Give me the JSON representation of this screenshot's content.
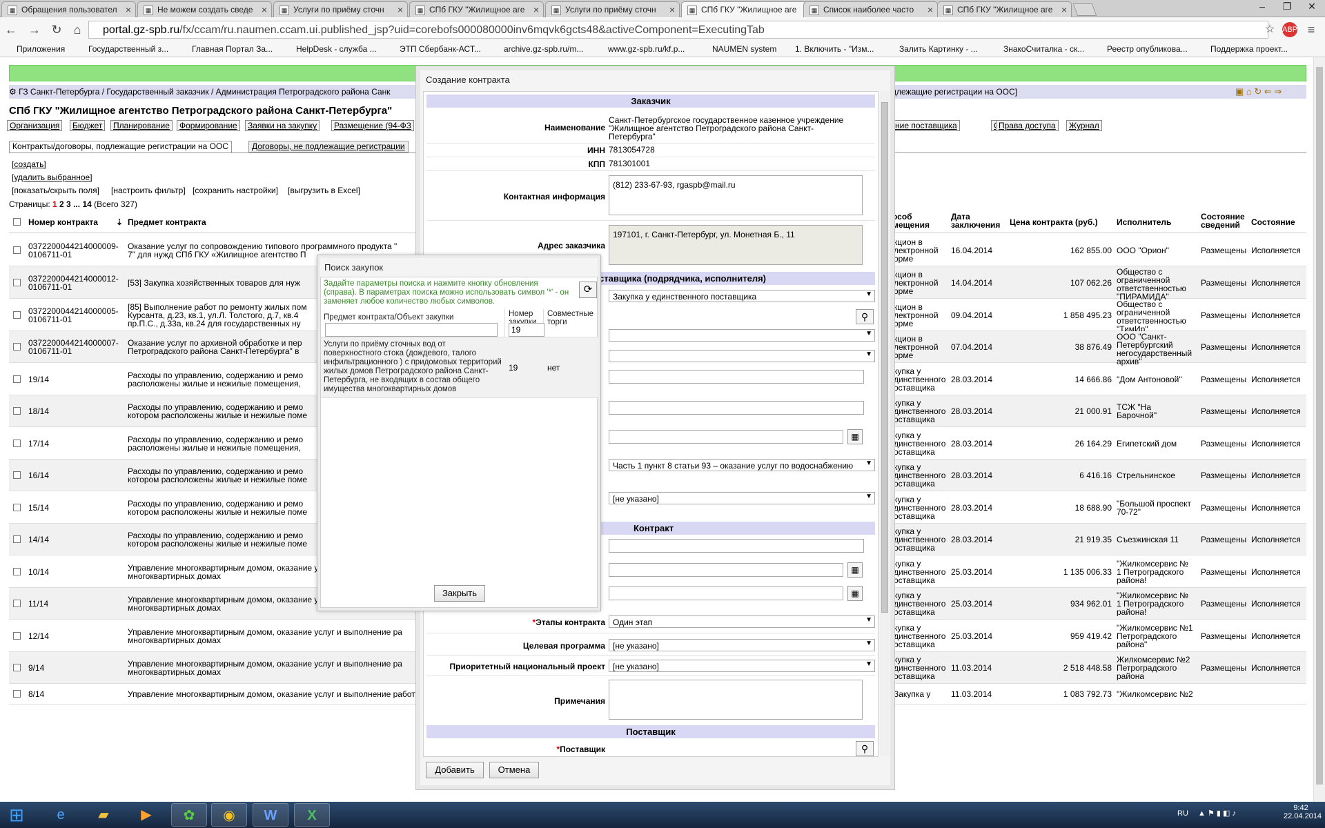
{
  "browser": {
    "tabs": [
      {
        "label": "Обращения пользовател",
        "active": false
      },
      {
        "label": "Не можем создать сведе",
        "active": false
      },
      {
        "label": "Услуги по приёму сточн",
        "active": false
      },
      {
        "label": "СПб ГКУ \"Жилищное аге",
        "active": false
      },
      {
        "label": "Услуги по приёму сточн",
        "active": false
      },
      {
        "label": "СПб ГКУ \"Жилищное аге",
        "active": true
      },
      {
        "label": "Список наиболее часто",
        "active": false
      },
      {
        "label": "СПб ГКУ \"Жилищное аге",
        "active": false
      }
    ],
    "url_host": "portal.gz-spb.ru",
    "url_path": "/fx/ccam/ru.naumen.ccam.ui.published_jsp?uid=corebofs000080000inv6mqvk6gcts48&activeComponent=ExecutingTab",
    "bookmarks": [
      {
        "label": "Приложения",
        "color": "#4a7fd6"
      },
      {
        "label": "Государственный з...",
        "color": "#1c5fb8"
      },
      {
        "label": "Главная Портал За...",
        "color": "#b8862c"
      },
      {
        "label": "HelpDesk - служба ...",
        "color": "#2c7fd1"
      },
      {
        "label": "ЭТП Сбербанк-АСТ...",
        "color": "#e8e8e8"
      },
      {
        "label": "archive.gz-spb.ru/m...",
        "color": "#d9362f"
      },
      {
        "label": "www.gz-spb.ru/kf.p...",
        "color": "#d9362f"
      },
      {
        "label": "NAUMEN system",
        "color": "#e8e8e8"
      },
      {
        "label": "1. Включить - \"Изм...",
        "color": "#555555"
      },
      {
        "label": "Залить Картинку - ...",
        "color": "#2c7fd1"
      },
      {
        "label": "ЗнакоСчиталка - ск...",
        "color": "#e8e8e8"
      },
      {
        "label": "Реестр опубликова...",
        "color": "#b8862c"
      },
      {
        "label": "Поддержка проект...",
        "color": "#d9362f"
      }
    ]
  },
  "page": {
    "breadcrumb": "ГЗ Санкт-Петербурга / Государственный заказчик / Администрация Петроградского района Санк",
    "breadcrumb_tail": "длежащие регистрации на ООС]",
    "org_title": "СПб ГКУ \"Жилищное агентство Петроградского района Санкт-Петербурга\"",
    "menu": [
      "Организация",
      "Бюджет",
      "Планирование",
      "Формирование",
      "Заявки на закупку",
      "Размещение (94-ФЗ",
      "ние поставщика",
      "ООС",
      "Права доступа",
      "Журнал"
    ],
    "subtabs": [
      "Контракты/договоры, подлежащие регистрации на ООС",
      "Договоры, не подлежащие регистрации"
    ],
    "actions": {
      "create": "[создать]",
      "delete": "[удалить выбранное]",
      "show_hide": "[показать/скрыть поля]",
      "filter": "[настроить фильтр]",
      "save": "[сохранить настройки]",
      "excel": "[выгрузить в Excel]"
    },
    "pager": {
      "label": "Страницы:",
      "current": "1",
      "pages": "2 3",
      "dots": "...",
      "last": "14",
      "total": "(Всего 327)"
    },
    "columns": {
      "number": "Номер контракта",
      "subject": "Предмет контракта",
      "method": "особ\nмещения",
      "date": "Дата\nзаключения",
      "price": "Цена контракта (руб.)",
      "executor": "Исполнитель",
      "info_state": "Состояние\nсведений",
      "state": "Состояние"
    },
    "rows": [
      {
        "number": "0372200044214000009-\n0106711-01",
        "subject": "Оказание услуг по сопровождению типового программного продукта \"\n7\" для нужд СПб ГКУ «Жилищное агентство П",
        "method": "кцион в\nлектронной\nорме",
        "date": "16.04.2014",
        "price": "162 855.00",
        "executor": "ООО \"Орион\"",
        "info_state": "Размещены",
        "state": "Исполняется"
      },
      {
        "number": "0372200044214000012-\n0106711-01",
        "subject": "[53] Закупка хозяйственных товаров для нуж",
        "method": "кцион в\nлектронной\nорме",
        "date": "14.04.2014",
        "price": "107 062.26",
        "executor": "Общество с\nограниченной\nответственностью\n\"ПИРАМИДА\"",
        "info_state": "Размещены",
        "state": "Исполняется"
      },
      {
        "number": "0372200044214000005-\n0106711-01",
        "subject": "[85] Выполнение работ по ремонту жилых пом\nКурсанта, д.23, кв.1, ул.Л. Толстого, д.7, кв.4\nпр.П.С., д.33а, кв.24 для государственных ну",
        "method": "кцион в\nлектронной\nорме",
        "date": "09.04.2014",
        "price": "1 858 495.23",
        "executor": "Общество с\nограниченной\nответственностью\n\"ТимИр\"",
        "info_state": "Размещены",
        "state": "Исполняется"
      },
      {
        "number": "0372200044214000007-\n0106711-01",
        "subject": "Оказание услуг по архивной обработке и пер\nПетроградского района Санкт-Петербурга\" в",
        "method": "кцион в\nлектронной\nорме",
        "date": "07.04.2014",
        "price": "38 876.49",
        "executor": "ООО \"Санкт-\nПетербургский\nнегосударственный\nархив\"",
        "info_state": "Размещены",
        "state": "Исполняется"
      },
      {
        "number": "19/14",
        "subject": "Расходы по управлению, содержанию и ремо\nрасположены жилые и нежилые помещения,",
        "method": "купка у\nдинственного\nоставщика",
        "date": "28.03.2014",
        "price": "14 666.86",
        "executor": "\"Дом Антоновой\"",
        "info_state": "Размещены",
        "state": "Исполняется"
      },
      {
        "number": "18/14",
        "subject": "Расходы по управлению, содержанию и ремо\nкотором расположены жилые и нежилые поме",
        "method": "купка у\nдинственного\nоставщика",
        "date": "28.03.2014",
        "price": "21 000.91",
        "executor": "ТСЖ \"На\nБарочной\"",
        "info_state": "Размещены",
        "state": "Исполняется"
      },
      {
        "number": "17/14",
        "subject": "Расходы по управлению, содержанию и ремо\nрасположены жилые и нежилые помещения,",
        "method": "купка у\nдинственного\nоставщика",
        "date": "28.03.2014",
        "price": "26 164.29",
        "executor": "Египетский дом",
        "info_state": "Размещены",
        "state": "Исполняется"
      },
      {
        "number": "16/14",
        "subject": "Расходы по управлению, содержанию и ремо\nкотором расположены жилые и нежилые поме",
        "method": "купка у\nдинственного\nоставщика",
        "date": "28.03.2014",
        "price": "6 416.16",
        "executor": "Стрельнинское",
        "info_state": "Размещены",
        "state": "Исполняется"
      },
      {
        "number": "15/14",
        "subject": "Расходы по управлению, содержанию и ремо\nкотором расположены жилые и нежилые поме",
        "method": "купка у\nдинственного\nоставщика",
        "date": "28.03.2014",
        "price": "18 688.90",
        "executor": "\"Большой проспект\n70-72\"",
        "info_state": "Размещены",
        "state": "Исполняется"
      },
      {
        "number": "14/14",
        "subject": "Расходы по управлению, содержанию и ремо\nкотором расположены жилые и нежилые поме",
        "method": "купка у\nдинственного\nоставщика",
        "date": "28.03.2014",
        "price": "21 919.35",
        "executor": "Съезжинская 11",
        "info_state": "Размещены",
        "state": "Исполняется"
      },
      {
        "number": "10/14",
        "subject": "Управление многоквартирным домом, оказание услуг и выполнение ра\nмногоквартирных домах",
        "method": "купка у\nдинственного\nоставщика",
        "date": "25.03.2014",
        "price": "1 135 006.33",
        "executor": "\"Жилкомсервис №\n1 Петроградского\nрайона!",
        "info_state": "Размещены",
        "state": "Исполняется"
      },
      {
        "number": "11/14",
        "subject": "Управление многоквартирным домом, оказание услуг и выполнение ра\nмногоквартирных домах",
        "method": "купка у\nдинственного\nоставщика",
        "date": "25.03.2014",
        "price": "934 962.01",
        "executor": "\"Жилкомсервис №\n1 Петроградского\nрайона!",
        "info_state": "Размещены",
        "state": "Исполняется"
      },
      {
        "number": "12/14",
        "subject": "Управление многоквартирным домом, оказание услуг и выполнение ра\nмногоквартирных домах",
        "method": "купка у\nдинственного\nоставщика",
        "date": "25.03.2014",
        "price": "959 419.42",
        "executor": "\"Жилкомсервис №1\nПетроградского\nрайона\"",
        "info_state": "Размещены",
        "state": "Исполняется"
      },
      {
        "number": "9/14",
        "subject": "Управление многоквартирным домом, оказание услуг и выполнение ра\nмногоквартирных домах",
        "method": "купка у\nдинственного\nоставщика",
        "date": "11.03.2014",
        "price": "2 518 448.58",
        "executor": "Жилкомсервис №2\nПетроградского\nрайона",
        "info_state": "Размещены",
        "state": "Исполняется"
      },
      {
        "number": "8/14",
        "subject": "Управление многоквартирным домом, оказание услуг и выполнение работ по надлежащему содержанию и ремонту общего имущества в  многоквартирных",
        "method": "Закупка у",
        "date": "11.03.2014",
        "price": "1 083 792.73",
        "executor": "\"Жилкомсервис №2",
        "info_state": "",
        "state": ""
      }
    ]
  },
  "contract_dialog": {
    "title": "Создание контракта",
    "sections": {
      "customer": "Заказчик",
      "supplier_method": "ставщика (подрядчика, исполнителя)",
      "contract": "Контракт",
      "supplier": "Поставщик"
    },
    "fields": {
      "name_label": "Наименование",
      "name_value": "Санкт-Петербургское государственное казенное учреждение\n\"Жилищное агентство Петроградского района Санкт-\nПетербурга\"",
      "inn_label": "ИНН",
      "inn_value": "7813054728",
      "kpp_label": "КПП",
      "kpp_value": "781301001",
      "contact_label": "Контактная информация",
      "contact_value": "(812) 233-67-93, rgaspb@mail.ru",
      "address_label": "Адрес заказчика",
      "address_value": "197101, г. Санкт-Петербург, ул. Монетная Б., 11",
      "method_select": "Закупка у единственного поставщика",
      "basis_select": "Часть 1 пункт 8 статьи 93 – оказание услуг по водоснабжению",
      "unspecified_select": "[не указано]",
      "stages_label": "Этапы контракта",
      "stages_value": "Один этап",
      "program_label": "Целевая программа",
      "program_value": "[не указано]",
      "project_label": "Приоритетный национальный проект",
      "project_value": "[не указано]",
      "notes_label": "Примечания",
      "supplier_label": "Поставщик",
      "required_mark": "*"
    },
    "buttons": {
      "add": "Добавить",
      "cancel": "Отмена"
    }
  },
  "search_dialog": {
    "title": "Поиск закупок",
    "info": "Задайте параметры поиска и нажмите кнопку обновления (справа). В параметрах поиска можно использовать символ '*' - он заменяет любое количество любых символов.",
    "col_subject": "Предмет контракта/Объект закупки",
    "col_number": "Номер\nзакупки",
    "col_joint": "Совместные\nторги",
    "subject_input": "",
    "number_input": "19",
    "result": {
      "subject": "Услуги по приёму сточных вод от поверхностного стока (дождевого, талого инфильтрационного ) с придомовых территорий жилых домов Петроградского района Санкт-Петербурга, не входящих в состав общего имущества многоквартирных домов",
      "number": "19",
      "joint": "нет"
    },
    "close": "Закрыть"
  },
  "taskbar": {
    "lang": "RU",
    "time": "9:42",
    "date": "22.04.2014"
  },
  "colors": {
    "accent_green": "#8fe27f",
    "section_blue": "#d8d8f4",
    "required_red": "#dd0000",
    "info_green": "#3a8a2a"
  }
}
